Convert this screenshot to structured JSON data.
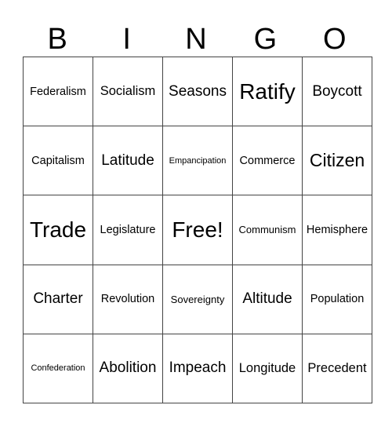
{
  "header": [
    "B",
    "I",
    "N",
    "G",
    "O"
  ],
  "rows": [
    [
      "Federalism",
      "Socialism",
      "Seasons",
      "Ratify",
      "Boycott"
    ],
    [
      "Capitalism",
      "Latitude",
      "Empancipation",
      "Commerce",
      "Citizen"
    ],
    [
      "Trade",
      "Legislature",
      "Free!",
      "Communism",
      "Hemisphere"
    ],
    [
      "Charter",
      "Revolution",
      "Sovereignty",
      "Altitude",
      "Population"
    ],
    [
      "Confederation",
      "Abolition",
      "Impeach",
      "Longitude",
      "Precedent"
    ]
  ]
}
